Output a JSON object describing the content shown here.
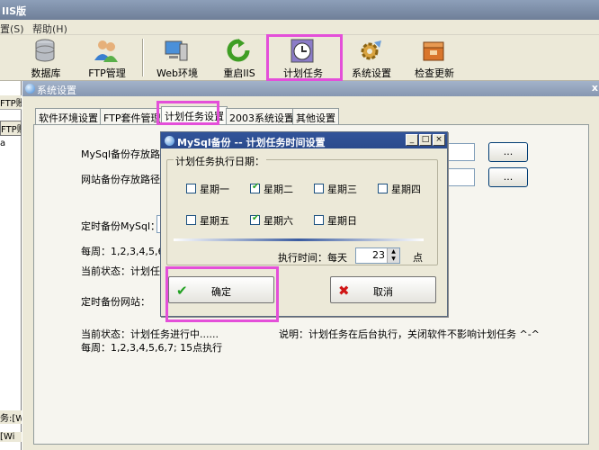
{
  "app": {
    "title": "IIS版"
  },
  "menu": {
    "items": [
      "置(S)",
      "帮助(H)"
    ]
  },
  "toolbar": {
    "items": [
      {
        "label": "数据库",
        "icon": "database-icon"
      },
      {
        "label": "FTP管理",
        "icon": "users-icon"
      },
      {
        "label": "Web环境",
        "icon": "web-server-icon"
      },
      {
        "label": "重启IIS",
        "icon": "restart-icon"
      },
      {
        "label": "计划任务",
        "icon": "clock-icon"
      },
      {
        "label": "系统设置",
        "icon": "settings-icon"
      },
      {
        "label": "检查更新",
        "icon": "update-icon"
      }
    ]
  },
  "left_panel": {
    "rows": [
      "FTP账",
      "FTP账",
      "a",
      "务:[W",
      "[Wi"
    ]
  },
  "system_window": {
    "title": "系统设置",
    "close": "x",
    "tabs": [
      "软件环境设置",
      "FTP套件管理",
      "计划任务设置",
      "2003系统设置",
      "其他设置"
    ],
    "active_tab": "计划任务设置",
    "fields": {
      "mysql_backup_path_label": "MySql备份存放路径",
      "web_backup_path_label": "网站备份存放路径",
      "browse_label": "..."
    },
    "schedule": {
      "mysql_label": "定时备份MySql：",
      "mysql_week": "每周：1,2,3,4,5,6,7,",
      "mysql_status": "当前状态：计划任务",
      "web_label": "定时备份网站：",
      "web_status": "当前状态：计划任务进行中......",
      "web_week": "每周：1,2,3,4,5,6,7; 15点执行",
      "note": "说明：计划任务在后台执行，关闭软件不影响计划任务 ^-^"
    }
  },
  "dialog": {
    "title": "MySql备份 -- 计划任务时间设置",
    "group_label": "计划任务执行日期：",
    "days": [
      {
        "label": "星期一",
        "checked": false
      },
      {
        "label": "星期二",
        "checked": true
      },
      {
        "label": "星期三",
        "checked": false
      },
      {
        "label": "星期四",
        "checked": false
      },
      {
        "label": "星期五",
        "checked": false
      },
      {
        "label": "星期六",
        "checked": true
      },
      {
        "label": "星期日",
        "checked": false
      }
    ],
    "time_label": "执行时间：每天",
    "time_value": "23",
    "time_unit": "点",
    "ok_label": "确定",
    "cancel_label": "取消"
  },
  "colors": {
    "highlight": "#e44fd9",
    "dialog_title": "#2a4a8c",
    "ok_check": "#21a121",
    "cancel_x": "#d01515"
  }
}
